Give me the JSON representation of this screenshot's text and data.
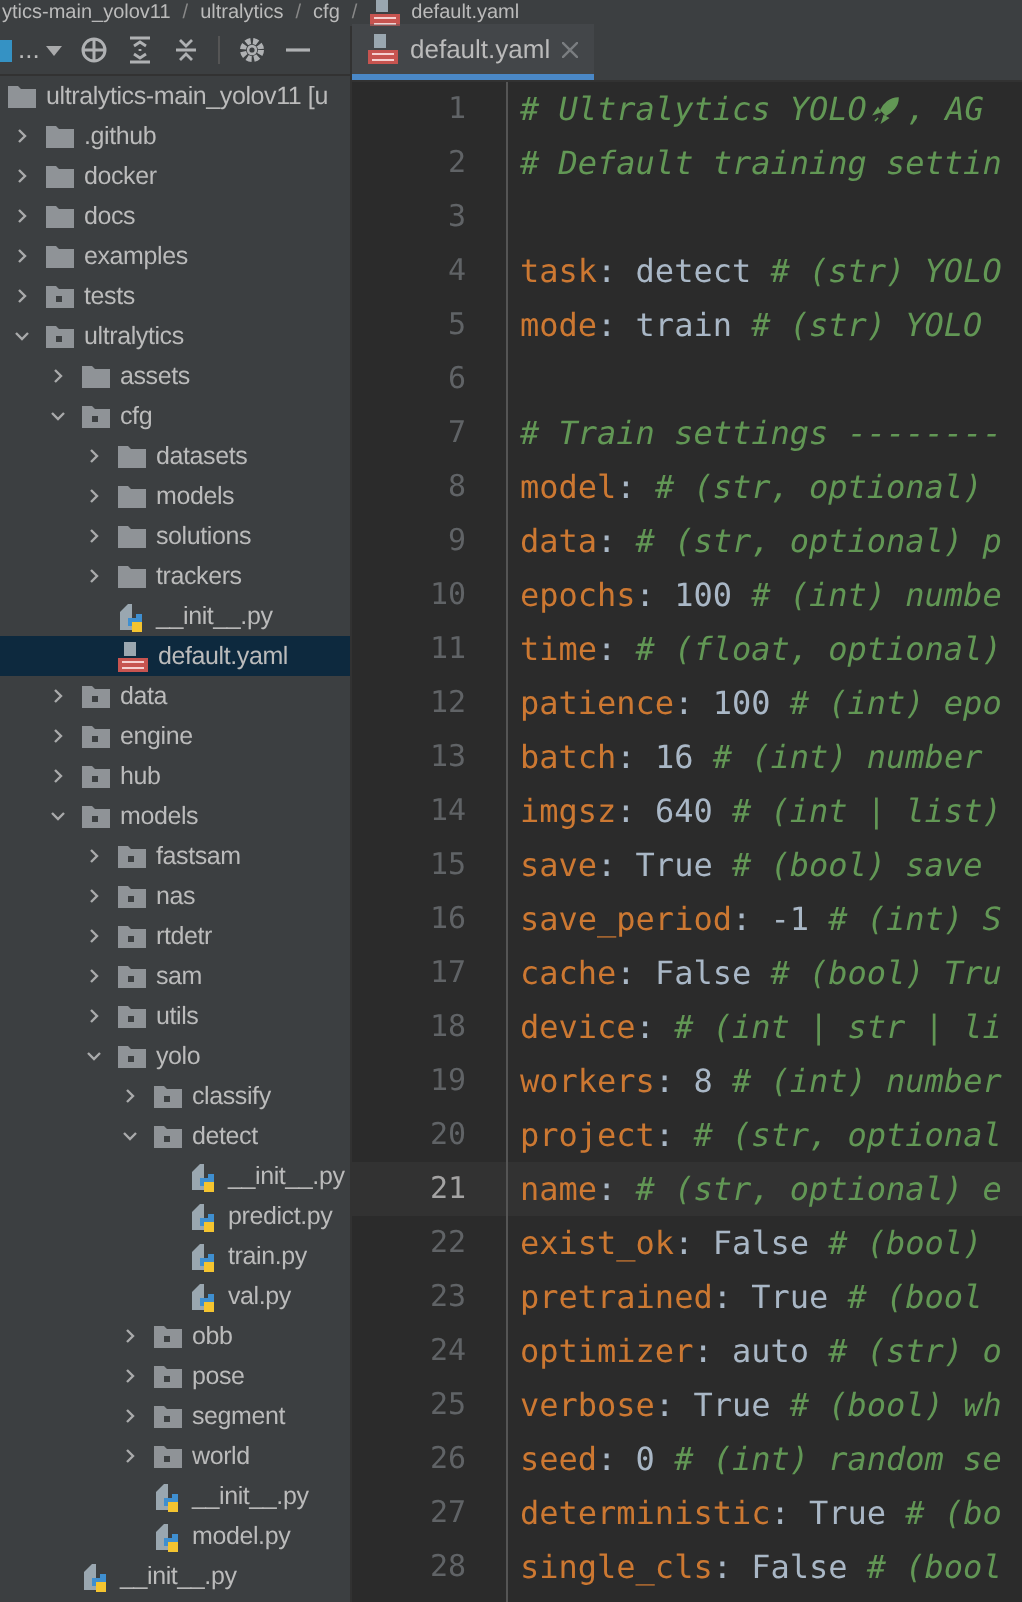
{
  "breadcrumb": [
    {
      "kind": "crumb",
      "text": "ytics-main_yolov11"
    },
    {
      "kind": "separator",
      "text": "/"
    },
    {
      "kind": "crumb",
      "text": "ultralytics"
    },
    {
      "kind": "separator",
      "text": "/"
    },
    {
      "kind": "crumb",
      "text": "cfg"
    },
    {
      "kind": "separator",
      "text": "/"
    },
    {
      "kind": "file",
      "text": "default.yaml"
    }
  ],
  "project_toolbar": {
    "view_label": "..."
  },
  "tree": [
    {
      "label": "ultralytics-main_yolov11 [u",
      "kind": "folder",
      "selected": false,
      "children": [
        {
          "label": ".github",
          "kind": "folder",
          "expanded": false,
          "selected": false
        },
        {
          "label": "docker",
          "kind": "folder",
          "expanded": false,
          "selected": false
        },
        {
          "label": "docs",
          "kind": "folder",
          "expanded": false,
          "selected": false
        },
        {
          "label": "examples",
          "kind": "folder",
          "expanded": false,
          "selected": false
        },
        {
          "label": "tests",
          "kind": "package",
          "expanded": false,
          "selected": false
        },
        {
          "label": "ultralytics",
          "kind": "package",
          "expanded": true,
          "selected": false,
          "children": [
            {
              "label": "assets",
              "kind": "folder",
              "expanded": false,
              "selected": false
            },
            {
              "label": "cfg",
              "kind": "package",
              "expanded": true,
              "selected": false,
              "children": [
                {
                  "label": "datasets",
                  "kind": "folder",
                  "expanded": false,
                  "selected": false
                },
                {
                  "label": "models",
                  "kind": "folder",
                  "expanded": false,
                  "selected": false
                },
                {
                  "label": "solutions",
                  "kind": "folder",
                  "expanded": false,
                  "selected": false
                },
                {
                  "label": "trackers",
                  "kind": "folder",
                  "expanded": false,
                  "selected": false
                },
                {
                  "label": "__init__.py",
                  "kind": "python",
                  "selected": false
                },
                {
                  "label": "default.yaml",
                  "kind": "yaml",
                  "selected": true
                }
              ]
            },
            {
              "label": "data",
              "kind": "package",
              "expanded": false,
              "selected": false
            },
            {
              "label": "engine",
              "kind": "package",
              "expanded": false,
              "selected": false
            },
            {
              "label": "hub",
              "kind": "package",
              "expanded": false,
              "selected": false
            },
            {
              "label": "models",
              "kind": "package",
              "expanded": true,
              "selected": false,
              "children": [
                {
                  "label": "fastsam",
                  "kind": "package",
                  "expanded": false,
                  "selected": false
                },
                {
                  "label": "nas",
                  "kind": "package",
                  "expanded": false,
                  "selected": false
                },
                {
                  "label": "rtdetr",
                  "kind": "package",
                  "expanded": false,
                  "selected": false
                },
                {
                  "label": "sam",
                  "kind": "package",
                  "expanded": false,
                  "selected": false
                },
                {
                  "label": "utils",
                  "kind": "package",
                  "expanded": false,
                  "selected": false
                },
                {
                  "label": "yolo",
                  "kind": "package",
                  "expanded": true,
                  "selected": false,
                  "children": [
                    {
                      "label": "classify",
                      "kind": "package",
                      "expanded": false,
                      "selected": false
                    },
                    {
                      "label": "detect",
                      "kind": "package",
                      "expanded": true,
                      "selected": false,
                      "children": [
                        {
                          "label": "__init__.py",
                          "kind": "python",
                          "selected": false
                        },
                        {
                          "label": "predict.py",
                          "kind": "python",
                          "selected": false
                        },
                        {
                          "label": "train.py",
                          "kind": "python",
                          "selected": false
                        },
                        {
                          "label": "val.py",
                          "kind": "python",
                          "selected": false
                        }
                      ]
                    },
                    {
                      "label": "obb",
                      "kind": "package",
                      "expanded": false,
                      "selected": false
                    },
                    {
                      "label": "pose",
                      "kind": "package",
                      "expanded": false,
                      "selected": false
                    },
                    {
                      "label": "segment",
                      "kind": "package",
                      "expanded": false,
                      "selected": false
                    },
                    {
                      "label": "world",
                      "kind": "package",
                      "expanded": false,
                      "selected": false
                    },
                    {
                      "label": "__init__.py",
                      "kind": "python",
                      "selected": false
                    },
                    {
                      "label": "model.py",
                      "kind": "python",
                      "selected": false
                    }
                  ]
                }
              ]
            },
            {
              "label": "__init__.py",
              "kind": "python",
              "selected": false
            }
          ]
        }
      ]
    }
  ],
  "tabs": [
    {
      "label": "default.yaml",
      "selected": true
    }
  ],
  "editor": {
    "lines": [
      {
        "number": "1",
        "current": false,
        "segments": [
          {
            "kind": "comment",
            "text": "# Ultralytics YOLO"
          },
          {
            "kind": "rocket"
          },
          {
            "kind": "comment",
            "text": ", AG"
          }
        ]
      },
      {
        "number": "2",
        "current": false,
        "segments": [
          {
            "kind": "comment",
            "text": "# Default training settin"
          }
        ]
      },
      {
        "number": "3",
        "current": false
      },
      {
        "number": "4",
        "current": false,
        "segments": [
          {
            "kind": "key",
            "text": "task"
          },
          {
            "kind": "plain",
            "text": ": detect "
          },
          {
            "kind": "comment",
            "text": "# (str) YOLO"
          }
        ]
      },
      {
        "number": "5",
        "current": false,
        "segments": [
          {
            "kind": "key",
            "text": "mode"
          },
          {
            "kind": "plain",
            "text": ": train "
          },
          {
            "kind": "comment",
            "text": "# (str) YOLO"
          }
        ]
      },
      {
        "number": "6",
        "current": false
      },
      {
        "number": "7",
        "current": false,
        "segments": [
          {
            "kind": "comment",
            "text": "# Train settings --------"
          }
        ]
      },
      {
        "number": "8",
        "current": false,
        "segments": [
          {
            "kind": "key",
            "text": "model"
          },
          {
            "kind": "plain",
            "text": ": "
          },
          {
            "kind": "comment",
            "text": "# (str, optional)"
          }
        ]
      },
      {
        "number": "9",
        "current": false,
        "segments": [
          {
            "kind": "key",
            "text": "data"
          },
          {
            "kind": "plain",
            "text": ": "
          },
          {
            "kind": "comment",
            "text": "# (str, optional) p"
          }
        ]
      },
      {
        "number": "10",
        "current": false,
        "segments": [
          {
            "kind": "key",
            "text": "epochs"
          },
          {
            "kind": "plain",
            "text": ": 100 "
          },
          {
            "kind": "comment",
            "text": "# (int) numbe"
          }
        ]
      },
      {
        "number": "11",
        "current": false,
        "segments": [
          {
            "kind": "key",
            "text": "time"
          },
          {
            "kind": "plain",
            "text": ": "
          },
          {
            "kind": "comment",
            "text": "# (float, optional)"
          }
        ]
      },
      {
        "number": "12",
        "current": false,
        "segments": [
          {
            "kind": "key",
            "text": "patience"
          },
          {
            "kind": "plain",
            "text": ": 100 "
          },
          {
            "kind": "comment",
            "text": "# (int) epo"
          }
        ]
      },
      {
        "number": "13",
        "current": false,
        "segments": [
          {
            "kind": "key",
            "text": "batch"
          },
          {
            "kind": "plain",
            "text": ": 16 "
          },
          {
            "kind": "comment",
            "text": "# (int) number"
          }
        ]
      },
      {
        "number": "14",
        "current": false,
        "segments": [
          {
            "kind": "key",
            "text": "imgsz"
          },
          {
            "kind": "plain",
            "text": ": 640 "
          },
          {
            "kind": "comment",
            "text": "# (int | list)"
          }
        ]
      },
      {
        "number": "15",
        "current": false,
        "segments": [
          {
            "kind": "key",
            "text": "save"
          },
          {
            "kind": "plain",
            "text": ": True "
          },
          {
            "kind": "comment",
            "text": "# (bool) save"
          }
        ]
      },
      {
        "number": "16",
        "current": false,
        "segments": [
          {
            "kind": "key",
            "text": "save_period"
          },
          {
            "kind": "plain",
            "text": ": -1 "
          },
          {
            "kind": "comment",
            "text": "# (int) S"
          }
        ]
      },
      {
        "number": "17",
        "current": false,
        "segments": [
          {
            "kind": "key",
            "text": "cache"
          },
          {
            "kind": "plain",
            "text": ": False "
          },
          {
            "kind": "comment",
            "text": "# (bool) Tru"
          }
        ]
      },
      {
        "number": "18",
        "current": false,
        "segments": [
          {
            "kind": "key",
            "text": "device"
          },
          {
            "kind": "plain",
            "text": ": "
          },
          {
            "kind": "comment",
            "text": "# (int | str | li"
          }
        ]
      },
      {
        "number": "19",
        "current": false,
        "segments": [
          {
            "kind": "key",
            "text": "workers"
          },
          {
            "kind": "plain",
            "text": ": 8 "
          },
          {
            "kind": "comment",
            "text": "# (int) number"
          }
        ]
      },
      {
        "number": "20",
        "current": false,
        "segments": [
          {
            "kind": "key",
            "text": "project"
          },
          {
            "kind": "plain",
            "text": ": "
          },
          {
            "kind": "comment",
            "text": "# (str, optional"
          }
        ]
      },
      {
        "number": "21",
        "current": true,
        "segments": [
          {
            "kind": "key",
            "text": "name"
          },
          {
            "kind": "plain",
            "text": ": "
          },
          {
            "kind": "comment",
            "text": "# (str, optional) e"
          }
        ]
      },
      {
        "number": "22",
        "current": false,
        "segments": [
          {
            "kind": "key",
            "text": "exist_ok"
          },
          {
            "kind": "plain",
            "text": ": False "
          },
          {
            "kind": "comment",
            "text": "# (bool)"
          }
        ]
      },
      {
        "number": "23",
        "current": false,
        "segments": [
          {
            "kind": "key",
            "text": "pretrained"
          },
          {
            "kind": "plain",
            "text": ": True "
          },
          {
            "kind": "comment",
            "text": "# (bool"
          }
        ]
      },
      {
        "number": "24",
        "current": false,
        "segments": [
          {
            "kind": "key",
            "text": "optimizer"
          },
          {
            "kind": "plain",
            "text": ": auto "
          },
          {
            "kind": "comment",
            "text": "# (str) o"
          }
        ]
      },
      {
        "number": "25",
        "current": false,
        "segments": [
          {
            "kind": "key",
            "text": "verbose"
          },
          {
            "kind": "plain",
            "text": ": True "
          },
          {
            "kind": "comment",
            "text": "# (bool) wh"
          }
        ]
      },
      {
        "number": "26",
        "current": false,
        "segments": [
          {
            "kind": "key",
            "text": "seed"
          },
          {
            "kind": "plain",
            "text": ": 0 "
          },
          {
            "kind": "comment",
            "text": "# (int) random se"
          }
        ]
      },
      {
        "number": "27",
        "current": false,
        "segments": [
          {
            "kind": "key",
            "text": "deterministic"
          },
          {
            "kind": "plain",
            "text": ": True "
          },
          {
            "kind": "comment",
            "text": "# (bo"
          }
        ]
      },
      {
        "number": "28",
        "current": false,
        "segments": [
          {
            "kind": "key",
            "text": "single_cls"
          },
          {
            "kind": "plain",
            "text": ": False "
          },
          {
            "kind": "comment",
            "text": "# (bool"
          }
        ]
      }
    ]
  }
}
